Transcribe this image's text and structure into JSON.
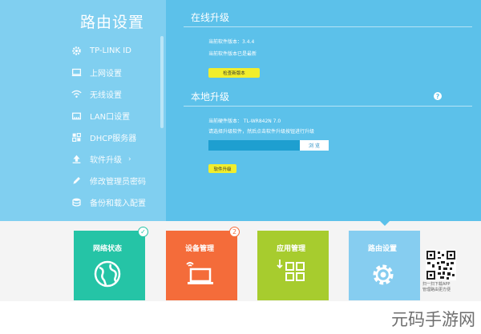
{
  "sidebar": {
    "title": "路由设置",
    "items": [
      {
        "label": "TP-LINK ID",
        "icon": "gear-icon"
      },
      {
        "label": "上网设置",
        "icon": "monitor-icon"
      },
      {
        "label": "无线设置",
        "icon": "wifi-icon"
      },
      {
        "label": "LAN口设置",
        "icon": "lan-port-icon"
      },
      {
        "label": "DHCP服务器",
        "icon": "dhcp-icon"
      },
      {
        "label": "软件升级",
        "icon": "upload-icon",
        "arrow": "›"
      },
      {
        "label": "修改管理员密码",
        "icon": "pencil-icon"
      },
      {
        "label": "备份和载入配置",
        "icon": "backup-icon"
      }
    ]
  },
  "online_upgrade": {
    "title": "在线升级",
    "current_version": "当前软件版本：3.4.4",
    "status": "当前软件版本已是最新",
    "check_button": "检查新版本"
  },
  "local_upgrade": {
    "title": "本地升级",
    "help": "?",
    "hardware_version": "当前硬件版本：  TL-WR842N 7.0",
    "instruction": "请选择升级软件，然后点击软件升级按钮进行升级",
    "file_value": "",
    "browse_button": "浏 览",
    "upgrade_button": "软件升级"
  },
  "tiles": [
    {
      "label": "网络状态",
      "color": "#25c4a6",
      "icon": "globe-icon"
    },
    {
      "label": "设备管理",
      "color": "#f46c3a",
      "icon": "laptop-icon"
    },
    {
      "label": "应用管理",
      "color": "#a7cc2e",
      "icon": "apps-grid-icon"
    },
    {
      "label": "路由设置",
      "color": "#86cdf0",
      "icon": "gear-icon"
    }
  ],
  "badges": {
    "network_check": "✓",
    "device_count": "2"
  },
  "qr_text": [
    "扫一扫下载APP",
    "管理路由更方便"
  ],
  "watermark": "元码手游网",
  "colors": {
    "primary_blue": "#5cc1ea",
    "sidebar_blue": "#80cff0",
    "yellow_button": "#f2ee2c"
  }
}
